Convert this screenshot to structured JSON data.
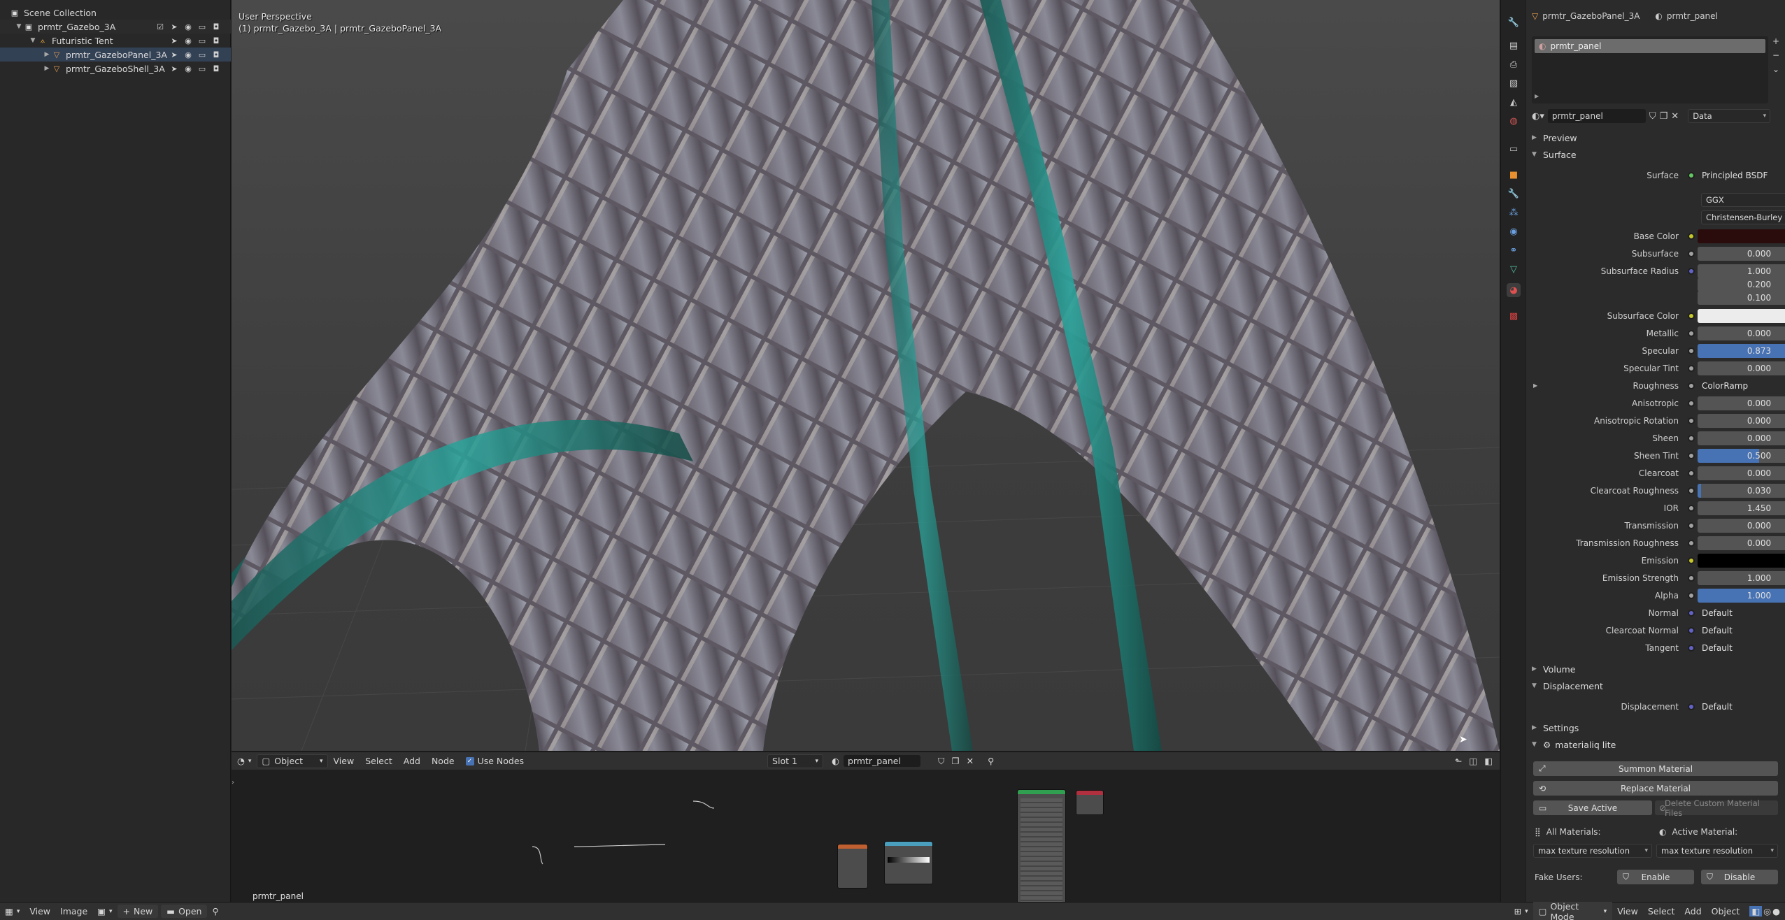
{
  "outliner": {
    "rows": [
      {
        "label": "Scene Collection",
        "icon": "collection-icon"
      },
      {
        "label": "prmtr_Gazebo_3A",
        "icon": "collection-icon"
      },
      {
        "label": "Futuristic Tent",
        "icon": "armature-icon"
      },
      {
        "label": "prmtr_GazeboPanel_3A",
        "icon": "mesh-icon"
      },
      {
        "label": "prmtr_GazeboShell_3A",
        "icon": "mesh-icon"
      }
    ]
  },
  "viewport": {
    "view_name": "User Perspective",
    "object_info": "(1) prmtr_Gazebo_3A | prmtr_GazeboPanel_3A"
  },
  "node_header": {
    "mode": "Object",
    "menus": [
      "View",
      "Select",
      "Add",
      "Node"
    ],
    "use_nodes": "Use Nodes",
    "slot": "Slot 1",
    "material": "prmtr_panel"
  },
  "node_editor": {
    "material_label": "prmtr_panel"
  },
  "statusbar": {
    "left": [
      "View",
      "Image"
    ],
    "new_label": "New",
    "open_label": "Open",
    "mode": "Object Mode",
    "menus": [
      "View",
      "Select",
      "Add",
      "Object"
    ]
  },
  "properties": {
    "breadcrumb_object": "prmtr_GazeboPanel_3A",
    "breadcrumb_material": "prmtr_panel",
    "slot_item": "prmtr_panel",
    "material_name": "prmtr_panel",
    "link_mode": "Data",
    "sections": {
      "preview": "Preview",
      "surface": "Surface",
      "volume": "Volume",
      "displacement": "Displacement",
      "settings": "Settings",
      "materialiq": "materialiq lite"
    },
    "surface_label": "Surface",
    "surface_value": "Principled BSDF",
    "distribution": "GGX",
    "subsurface_method": "Christensen-Burley",
    "fields": [
      {
        "label": "Base Color",
        "value": "",
        "dot": "yellow",
        "color": "#2a0c0c"
      },
      {
        "label": "Subsurface",
        "value": "0.000",
        "dot": "gray"
      },
      {
        "label": "Subsurface Radius",
        "value": "1.000",
        "dot": "purple"
      },
      {
        "label": "",
        "value": "0.200",
        "dot": "none"
      },
      {
        "label": "",
        "value": "0.100",
        "dot": "none"
      },
      {
        "label": "Subsurface Color",
        "value": "",
        "dot": "yellow",
        "color": "#ececec"
      },
      {
        "label": "Metallic",
        "value": "0.000",
        "dot": "gray"
      },
      {
        "label": "Specular",
        "value": "0.873",
        "dot": "gray",
        "fill": 0.873
      },
      {
        "label": "Specular Tint",
        "value": "0.000",
        "dot": "gray"
      },
      {
        "label": "Roughness",
        "value": "ColorRamp",
        "dot": "gray",
        "link": true
      },
      {
        "label": "Anisotropic",
        "value": "0.000",
        "dot": "gray"
      },
      {
        "label": "Anisotropic Rotation",
        "value": "0.000",
        "dot": "gray"
      },
      {
        "label": "Sheen",
        "value": "0.000",
        "dot": "gray"
      },
      {
        "label": "Sheen Tint",
        "value": "0.500",
        "dot": "gray",
        "fill": 0.5
      },
      {
        "label": "Clearcoat",
        "value": "0.000",
        "dot": "gray"
      },
      {
        "label": "Clearcoat Roughness",
        "value": "0.030",
        "dot": "gray",
        "fill": 0.03
      },
      {
        "label": "IOR",
        "value": "1.450",
        "dot": "gray"
      },
      {
        "label": "Transmission",
        "value": "0.000",
        "dot": "gray"
      },
      {
        "label": "Transmission Roughness",
        "value": "0.000",
        "dot": "gray"
      },
      {
        "label": "Emission",
        "value": "",
        "dot": "yellow",
        "color": "#000000"
      },
      {
        "label": "Emission Strength",
        "value": "1.000",
        "dot": "gray"
      },
      {
        "label": "Alpha",
        "value": "1.000",
        "dot": "gray",
        "fill": 1.0
      },
      {
        "label": "Normal",
        "value": "Default",
        "dot": "purple",
        "link": true
      },
      {
        "label": "Clearcoat Normal",
        "value": "Default",
        "dot": "purple",
        "link": true
      },
      {
        "label": "Tangent",
        "value": "Default",
        "dot": "purple",
        "link": true
      }
    ],
    "displacement_label": "Displacement",
    "displacement_value": "Default",
    "materialiq": {
      "summon": "Summon Material",
      "replace": "Replace Material",
      "save_active": "Save Active",
      "delete_custom": "Delete Custom Material Files",
      "all_materials": "All Materials:",
      "active_material": "Active Material:",
      "max_res_1": "max texture resolution",
      "max_res_2": "max texture resolution",
      "fake_users": "Fake Users:",
      "enable": "Enable",
      "disable": "Disable"
    }
  },
  "colors": {
    "accent": "#4772b3",
    "panel": "#2b2b2b",
    "field": "#545454"
  }
}
